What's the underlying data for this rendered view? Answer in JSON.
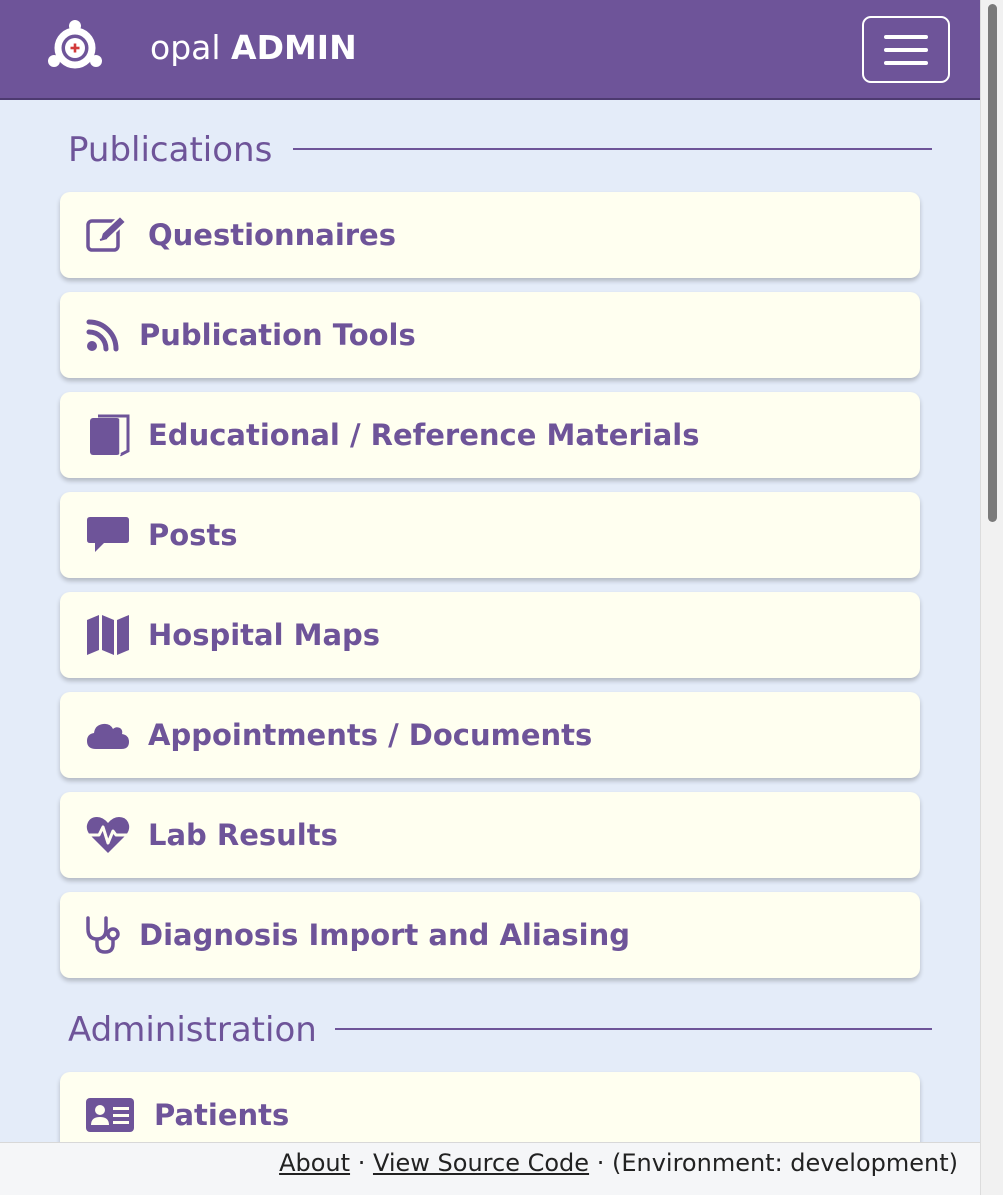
{
  "header": {
    "brand_light": "opal",
    "brand_bold": "ADMIN",
    "background_color": "#6e5499"
  },
  "sections": [
    {
      "title": "Publications",
      "items": [
        {
          "label": "Questionnaires",
          "icon": "edit-icon"
        },
        {
          "label": "Publication Tools",
          "icon": "rss-icon"
        },
        {
          "label": "Educational / Reference Materials",
          "icon": "book-icon"
        },
        {
          "label": "Posts",
          "icon": "comment-icon"
        },
        {
          "label": "Hospital Maps",
          "icon": "map-icon"
        },
        {
          "label": "Appointments / Documents",
          "icon": "cloud-icon"
        },
        {
          "label": "Lab Results",
          "icon": "heartbeat-icon"
        },
        {
          "label": "Diagnosis Import and Aliasing",
          "icon": "stethoscope-icon"
        }
      ]
    },
    {
      "title": "Administration",
      "items": [
        {
          "label": "Patients",
          "icon": "id-card-icon"
        }
      ]
    }
  ],
  "footer": {
    "about": "About",
    "separator": "·",
    "source": "View Source Code",
    "environment": "(Environment: development)"
  },
  "colors": {
    "accent": "#6e5499",
    "card_background": "#fffff0",
    "page_background": "#e4ecf9"
  }
}
